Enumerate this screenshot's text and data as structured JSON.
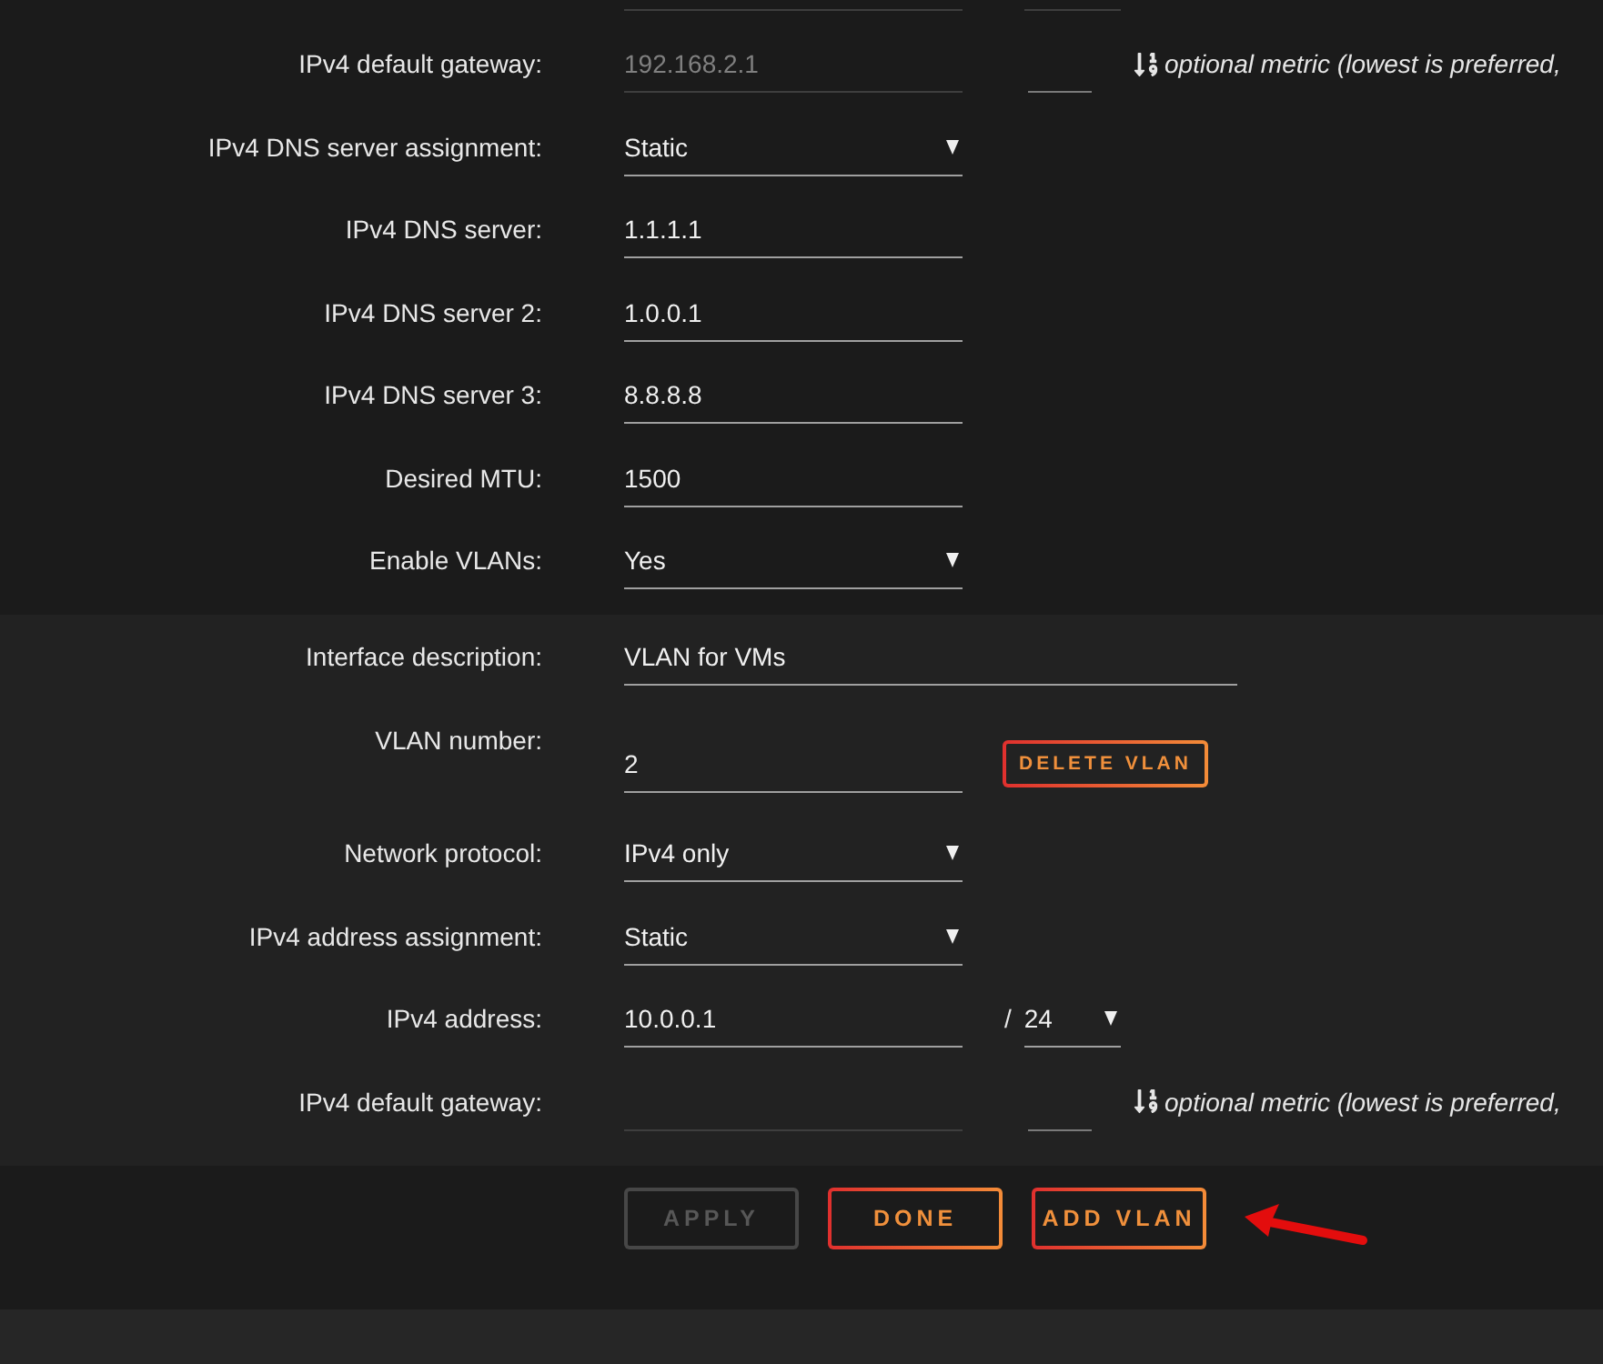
{
  "interface": {
    "rows": [
      {
        "kind": "partial_address"
      },
      {
        "kind": "gateway",
        "label": "IPv4 default gateway:",
        "placeholder": "192.168.2.1",
        "hint": "optional metric (lowest is preferred,"
      },
      {
        "kind": "select",
        "label": "IPv4 DNS server assignment:",
        "value": "Static"
      },
      {
        "kind": "text",
        "label": "IPv4 DNS server:",
        "value": "1.1.1.1"
      },
      {
        "kind": "text",
        "label": "IPv4 DNS server 2:",
        "value": "1.0.0.1"
      },
      {
        "kind": "text",
        "label": "IPv4 DNS server 3:",
        "value": "8.8.8.8"
      },
      {
        "kind": "text",
        "label": "Desired MTU:",
        "value": "1500"
      },
      {
        "kind": "select",
        "label": "Enable VLANs:",
        "value": "Yes"
      }
    ]
  },
  "vlan": {
    "rows": [
      {
        "kind": "long_text",
        "label": "Interface description:",
        "value": "VLAN for VMs"
      },
      {
        "kind": "vlan_number",
        "label": "VLAN number:",
        "value": "2",
        "button": "DELETE VLAN"
      },
      {
        "kind": "select",
        "label": "Network protocol:",
        "value": "IPv4 only"
      },
      {
        "kind": "select",
        "label": "IPv4 address assignment:",
        "value": "Static"
      },
      {
        "kind": "address",
        "label": "IPv4 address:",
        "value": "10.0.0.1",
        "separator": "/",
        "prefix": "24"
      },
      {
        "kind": "gateway",
        "label": "IPv4 default gateway:",
        "hint": "optional metric (lowest is preferred,"
      }
    ]
  },
  "actions": [
    {
      "label": "APPLY",
      "disabled": true
    },
    {
      "label": "DONE",
      "disabled": false
    },
    {
      "label": "ADD VLAN",
      "disabled": false
    }
  ]
}
